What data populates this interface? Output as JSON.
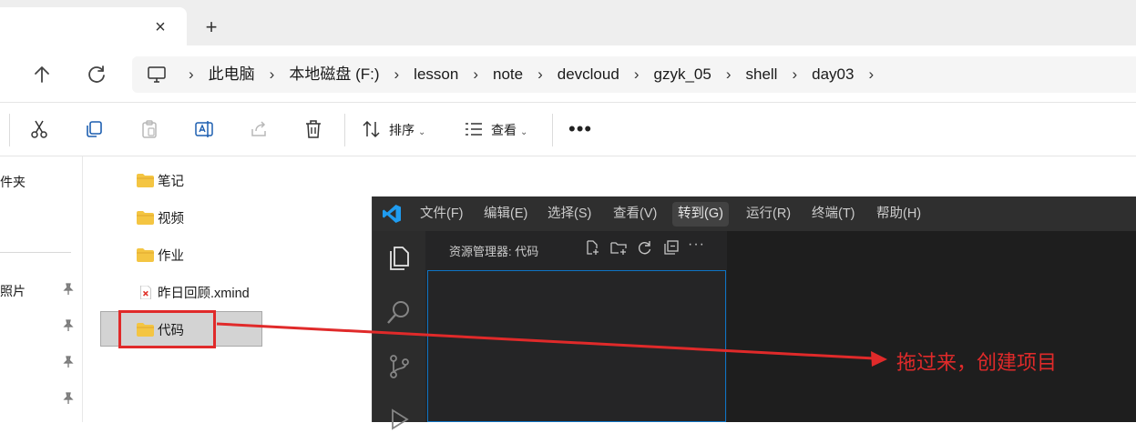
{
  "tabs": {
    "close_glyph": "×",
    "new_tab_glyph": "+"
  },
  "breadcrumb": {
    "separator": "›",
    "items": [
      "此电脑",
      "本地磁盘 (F:)",
      "lesson",
      "note",
      "devcloud",
      "gzyk_05",
      "shell",
      "day03"
    ]
  },
  "toolbar": {
    "sort_label": "排序",
    "view_label": "查看",
    "more_label": "•••",
    "caret": "⌄"
  },
  "navpane": {
    "items": [
      "件夹",
      "照片"
    ]
  },
  "files": [
    {
      "name": "笔记",
      "type": "folder"
    },
    {
      "name": "视频",
      "type": "folder"
    },
    {
      "name": "作业",
      "type": "folder"
    },
    {
      "name": "昨日回顾.xmind",
      "type": "xmind"
    },
    {
      "name": "代码",
      "type": "folder",
      "selected": true
    }
  ],
  "vscode": {
    "menu": [
      "文件(F)",
      "编辑(E)",
      "选择(S)",
      "查看(V)",
      "转到(G)",
      "运行(R)",
      "终端(T)",
      "帮助(H)"
    ],
    "explorer_title": "资源管理器: 代码",
    "explorer_more": "···"
  },
  "annotation": {
    "text": "拖过来，创建项目",
    "color": "#e02a2a"
  },
  "colors": {
    "accent_red": "#e02a2a",
    "vscode_blue": "#0e74c4",
    "folder_yellow": "#f4c542"
  }
}
